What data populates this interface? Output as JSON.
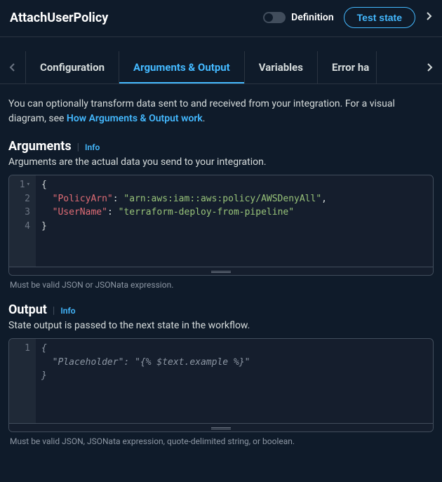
{
  "header": {
    "title": "AttachUserPolicy",
    "toggle_label": "Definition",
    "test_button": "Test state"
  },
  "tabs": {
    "items": [
      "Configuration",
      "Arguments & Output",
      "Variables",
      "Error ha"
    ],
    "active_index": 1
  },
  "intro": {
    "pre": "You can optionally transform data sent to and received from your integration. For a visual diagram, see ",
    "link": "How Arguments & Output work",
    "post": "."
  },
  "arguments": {
    "title": "Arguments",
    "info": "Info",
    "desc": "Arguments are the actual data you send to your integration.",
    "code_lines": [
      {
        "n": "1",
        "fold": true,
        "indent": 0,
        "brace": "{"
      },
      {
        "n": "2",
        "indent": 1,
        "key": "\"PolicyArn\"",
        "sep": ": ",
        "val": "\"arn:aws:iam::aws:policy/AWSDenyAll\"",
        "comma": ","
      },
      {
        "n": "3",
        "indent": 1,
        "key": "\"UserName\"",
        "sep": ": ",
        "val": "\"terraform-deploy-from-pipeline\""
      },
      {
        "n": "4",
        "indent": 0,
        "brace": "}"
      }
    ],
    "hint": "Must be valid JSON or JSONata expression."
  },
  "output": {
    "title": "Output",
    "info": "Info",
    "desc": "State output is passed to the next state in the workflow.",
    "code_lines": [
      {
        "n": "1"
      }
    ],
    "placeholder": {
      "open": "{",
      "key": "\"Placeholder\"",
      "sep": ": ",
      "val": "\"{% $text.example %}\"",
      "close": "}"
    },
    "hint": "Must be valid JSON, JSONata expression, quote-delimited string, or boolean."
  }
}
